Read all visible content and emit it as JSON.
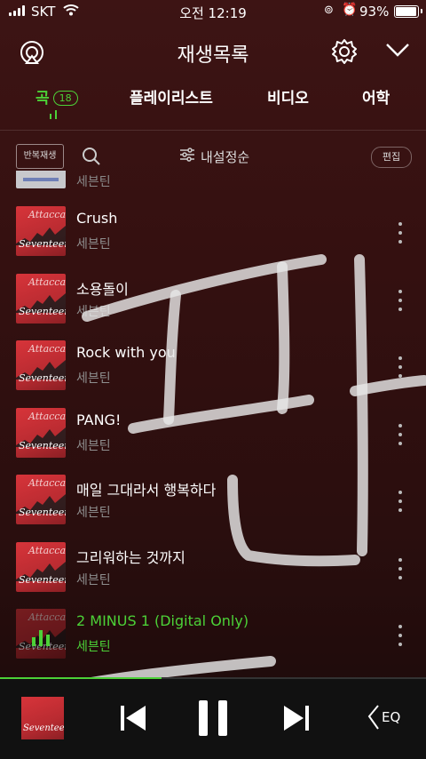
{
  "status": {
    "carrier": "SKT",
    "time": "오전 12:19",
    "battery": "93%",
    "battery_level": 0.93
  },
  "header": {
    "title": "재생목록"
  },
  "tabs": [
    {
      "label": "곡",
      "badge": "18"
    },
    {
      "label": "플레이리스트"
    },
    {
      "label": "비디오"
    },
    {
      "label": "어학"
    }
  ],
  "toolbar": {
    "repeat": "반복재생",
    "sort": "내설정순",
    "edit": "편집"
  },
  "list": {
    "partial_artist": "세븐틴",
    "songs": [
      {
        "title": "Crush",
        "artist": "세븐틴"
      },
      {
        "title": "소용돌이",
        "artist": "세븐틴"
      },
      {
        "title": "Rock with you",
        "artist": "세븐틴"
      },
      {
        "title": "PANG!",
        "artist": "세븐틴"
      },
      {
        "title": "매일 그대라서 행복하다",
        "artist": "세븐틴"
      },
      {
        "title": "그리워하는 것까지",
        "artist": "세븐틴"
      },
      {
        "title": "2 MINUS 1 (Digital Only)",
        "artist": "세븐틴",
        "playing": true
      }
    ],
    "album_text_top": "Attacca",
    "album_text_bottom": "Seventeen"
  },
  "player": {
    "eq_label": "EQ",
    "progress": 0.38
  },
  "colors": {
    "accent": "#4cd137",
    "background": "#341010"
  },
  "icons": [
    "cast-icon",
    "gear-icon",
    "chevron-down-icon",
    "search-icon",
    "sort-icon",
    "more-icon",
    "prev-icon",
    "pause-icon",
    "next-icon",
    "eq-icon"
  ]
}
